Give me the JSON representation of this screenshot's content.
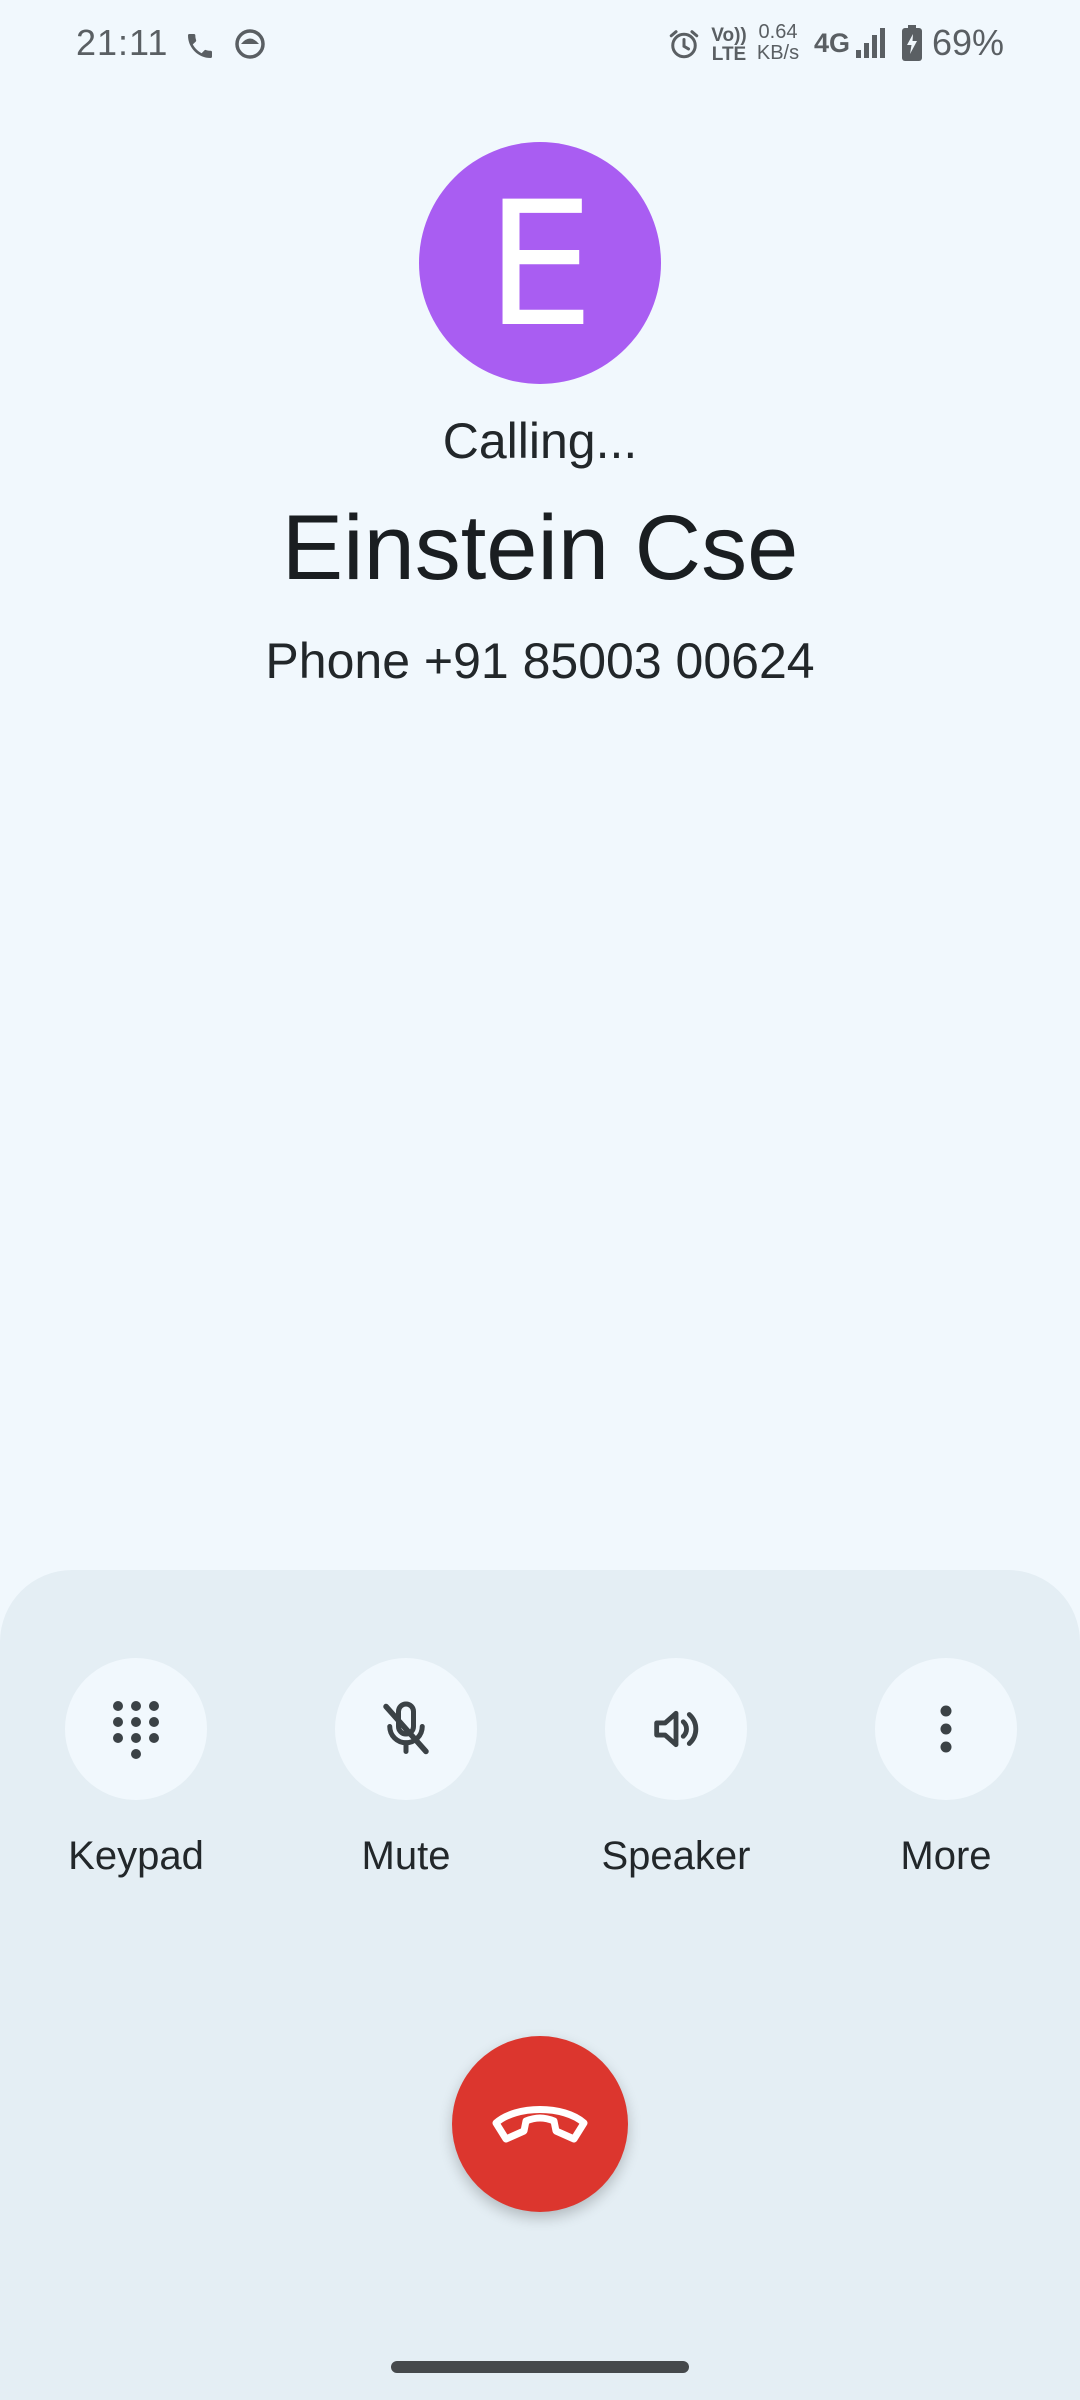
{
  "status_bar": {
    "time": "21:11",
    "icons": [
      "phone-icon",
      "messenger-icon",
      "alarm-icon",
      "volte-icon",
      "signal-icon",
      "battery-charging-icon"
    ],
    "volte_top": "Vo))",
    "volte_bottom": "LTE",
    "speed_value": "0.64",
    "speed_unit": "KB/s",
    "network": "4G",
    "battery": "69%"
  },
  "caller": {
    "avatar_letter": "E",
    "avatar_color": "#a95df2",
    "status": "Calling...",
    "name": "Einstein Cse",
    "phone": "Phone +91 85003 00624"
  },
  "controls": [
    {
      "label": "Keypad",
      "icon": "dialpad-icon"
    },
    {
      "label": "Mute",
      "icon": "mic-off-icon"
    },
    {
      "label": "Speaker",
      "icon": "speaker-icon"
    },
    {
      "label": "More",
      "icon": "more-vert-icon"
    }
  ],
  "end_call": {
    "icon": "call-end-icon",
    "color": "#dc362e"
  }
}
